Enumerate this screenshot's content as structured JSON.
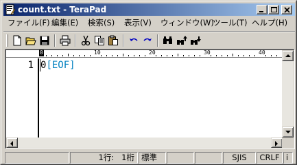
{
  "window": {
    "title": "count.txt - TeraPad",
    "icon": "terapad-app-icon"
  },
  "menu": {
    "items": [
      "ファイル(F)",
      "編集(E)",
      "検索(S)",
      "表示(V)",
      "ウィンドウ(W)",
      "ツール(T)",
      "ヘルプ(H)"
    ]
  },
  "toolbar": {
    "buttons": [
      "new-file-icon",
      "open-folder-icon",
      "save-icon",
      "print-icon",
      "cut-icon",
      "copy-icon",
      "paste-icon",
      "undo-icon",
      "redo-icon",
      "find-icon",
      "find-prev-icon",
      "find-next-icon"
    ]
  },
  "ruler": {
    "labels": [
      "0",
      "10",
      "20",
      "30",
      "40"
    ]
  },
  "editor": {
    "line_number": "1",
    "text": "0",
    "eof_marker": "[EOF]",
    "eof_color": "#0080c0"
  },
  "status": {
    "line": "1行:",
    "column": "1桁",
    "mode": "標準",
    "encoding": "SJIS",
    "newline": "CRLF",
    "ime": "i"
  }
}
